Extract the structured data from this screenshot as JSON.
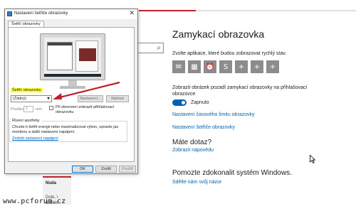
{
  "settings": {
    "title": "Zamykací obrazovka",
    "apps_desc": "Zvolte aplikace, které budou zobrazovat rychlý stav.",
    "app_tiles": [
      {
        "icon": "mail-icon",
        "glyph": "✉"
      },
      {
        "icon": "calendar-icon",
        "glyph": "▦"
      },
      {
        "icon": "alarm-icon",
        "glyph": "⏰"
      },
      {
        "icon": "skype-icon",
        "glyph": "S"
      },
      {
        "icon": "add-icon",
        "glyph": "+"
      },
      {
        "icon": "add-icon",
        "glyph": "+"
      },
      {
        "icon": "add-icon",
        "glyph": "+"
      }
    ],
    "bg_desc": "Zobrazit obrázek pozadí zamykací obrazovky na přihlašovací obrazovce",
    "toggle_label": "Zapnuto",
    "toggle_on": true,
    "link_timeout": "Nastavení časového limitu obrazovky",
    "link_saver": "Nastavení šetřiče obrazovky",
    "question_title": "Máte dotaz?",
    "link_help": "Zobrazit nápovědu",
    "improve_title": "Pomozte zdokonalit systém Windows.",
    "link_feedback": "Sdělte nám svůj názor",
    "accent": "#0063b1"
  },
  "card": {
    "title": "Nuda",
    "text": "Dole, \\ dalším"
  },
  "watermark": "www.pcforum.cz",
  "dialog": {
    "title": "Nastavení šetřiče obrazovky",
    "tab": "Šetřič obrazovky",
    "saver_label": "Šetřič obrazovky",
    "saver_value": "(Žádný)",
    "settings_btn": "Nastavení...",
    "preview_btn": "Náhled",
    "wait_label": "Prodleva:",
    "wait_value": "1",
    "wait_unit": "min",
    "resume_label": "Při obnovení zobrazit přihlašovací obrazovku",
    "power_title": "Řízení spotřeby",
    "power_text": "Chcete-li šetřit energii nebo maximalizovat výkon, upravte jas monitoru a další nastavení napájení.",
    "power_link": "Změnit nastavení napájení",
    "ok_btn": "OK",
    "cancel_btn": "Zrušit",
    "apply_btn": "Použít",
    "highlight_color": "#ffff33",
    "arrow_color": "#c0202c"
  }
}
